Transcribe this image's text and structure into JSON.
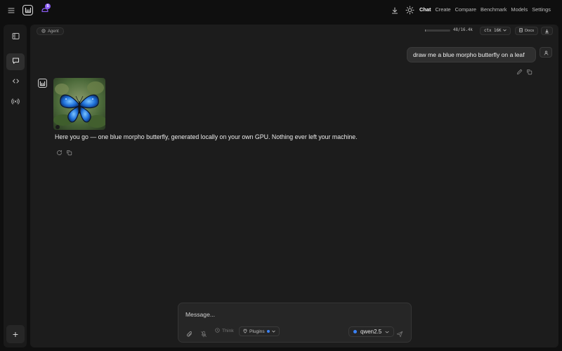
{
  "topbar": {
    "notification_count": "5",
    "nav": [
      {
        "label": "Chat",
        "active": true
      },
      {
        "label": "Create",
        "active": false
      },
      {
        "label": "Compare",
        "active": false
      },
      {
        "label": "Benchmark",
        "active": false
      },
      {
        "label": "Models",
        "active": false
      },
      {
        "label": "Settings",
        "active": false
      }
    ]
  },
  "sidebar": {
    "items": [
      {
        "icon": "panel-icon",
        "active": false
      },
      {
        "icon": "chat-bubble-icon",
        "active": true
      },
      {
        "icon": "code-icon",
        "active": false
      },
      {
        "icon": "broadcast-icon",
        "active": false
      }
    ],
    "new_label": "+"
  },
  "header": {
    "mode_label": "Agent",
    "context_usage": "48/16.4k",
    "context_fraction": 0.003,
    "context_size_label": "ctx 16K",
    "docs_label": "Docs"
  },
  "messages": {
    "user_text": "draw me a blue morpho butterfly on a leaf",
    "assistant_text": "Here you go — one blue morpho butterfly, generated locally on your own GPU. Nothing ever left your machine."
  },
  "composer": {
    "placeholder": "Message...",
    "think_label": "Think",
    "plugins_label": "Plugins",
    "model_label": "qwen2.5"
  },
  "colors": {
    "accent_purple": "#8b5cf6",
    "accent_blue": "#3b82f6",
    "butterfly_blue": "#1e6fd9"
  }
}
